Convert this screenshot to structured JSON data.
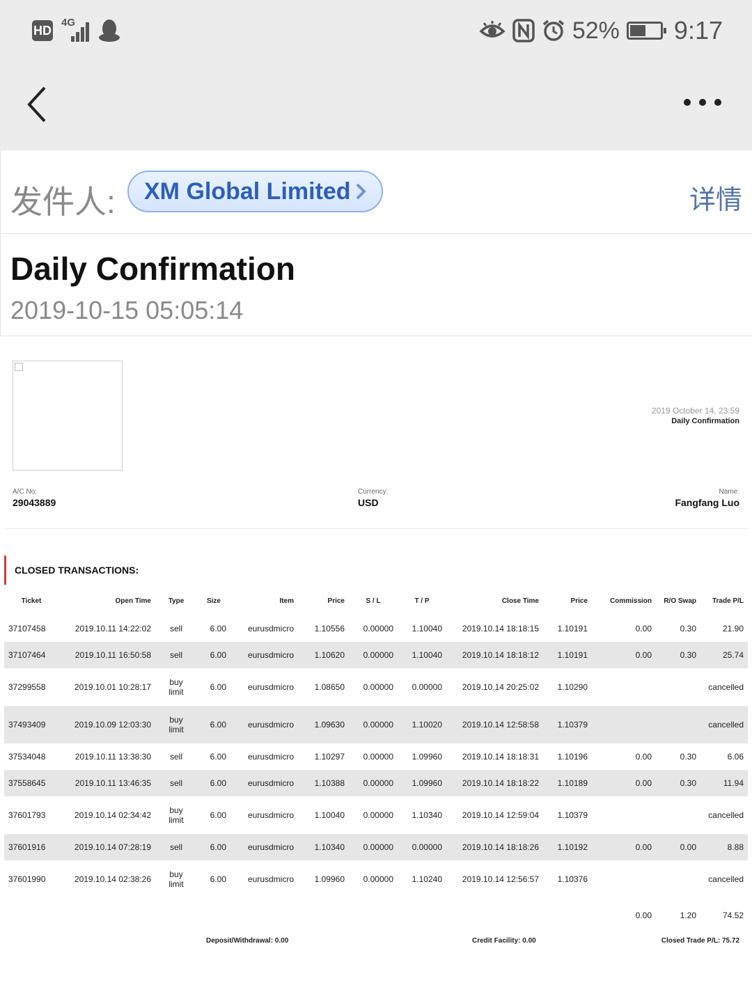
{
  "status_bar": {
    "hd_label": "HD",
    "network_label": "4G",
    "battery_percent_label": "52%",
    "battery_level": 0.52,
    "time": "9:17",
    "icons": [
      "hd-icon",
      "signal-icon",
      "qq-penguin-icon",
      "eye-icon",
      "nfc-icon",
      "alarm-icon",
      "battery-icon"
    ]
  },
  "nav": {
    "back_icon": "chevron-left-icon",
    "more_icon": "more-dots-icon"
  },
  "sender": {
    "label": "发件人:",
    "name": "XM Global Limited",
    "details_label": "详情"
  },
  "subject": {
    "title": "Daily Confirmation",
    "date": "2019-10-15 05:05:14"
  },
  "email": {
    "report_date": "2019 October 14, 23:59",
    "report_title": "Daily Confirmation",
    "account": {
      "ac_label": "A/C No:",
      "ac_value": "29043889",
      "currency_label": "Currency:",
      "currency_value": "USD",
      "name_label": "Name:",
      "name_value": "Fangfang Luo"
    },
    "section_title": "CLOSED TRANSACTIONS:",
    "columns": [
      "Ticket",
      "Open Time",
      "Type",
      "Size",
      "Item",
      "Price",
      "S / L",
      "T / P",
      "Close Time",
      "Price",
      "Commission",
      "R/O Swap",
      "Trade P/L"
    ],
    "rows": [
      {
        "ticket": "37107458",
        "open_time": "2019.10.11 14:22:02",
        "type": "sell",
        "type2": "",
        "size": "6.00",
        "item": "eurusdmicro",
        "price": "1.10556",
        "sl": "0.00000",
        "tp": "1.10040",
        "close_time": "2019.10.14 18:18:15",
        "close_price": "1.10191",
        "commission": "0.00",
        "swap": "0.30",
        "pl": "21.90"
      },
      {
        "ticket": "37107464",
        "open_time": "2019.10.11 16:50:58",
        "type": "sell",
        "type2": "",
        "size": "6.00",
        "item": "eurusdmicro",
        "price": "1.10620",
        "sl": "0.00000",
        "tp": "1.10040",
        "close_time": "2019.10.14 18:18:12",
        "close_price": "1.10191",
        "commission": "0.00",
        "swap": "0.30",
        "pl": "25.74"
      },
      {
        "ticket": "37299558",
        "open_time": "2019.10.01 10:28:17",
        "type": "buy",
        "type2": "limit",
        "size": "6.00",
        "item": "eurusdmicro",
        "price": "1.08650",
        "sl": "0.00000",
        "tp": "0.00000",
        "close_time": "2019.10.14 20:25:02",
        "close_price": "1.10290",
        "commission": "",
        "swap": "",
        "pl": "cancelled"
      },
      {
        "ticket": "37493409",
        "open_time": "2019.10.09 12:03:30",
        "type": "buy",
        "type2": "limit",
        "size": "6.00",
        "item": "eurusdmicro",
        "price": "1.09630",
        "sl": "0.00000",
        "tp": "1.10020",
        "close_time": "2019.10.14 12:58:58",
        "close_price": "1.10379",
        "commission": "",
        "swap": "",
        "pl": "cancelled"
      },
      {
        "ticket": "37534048",
        "open_time": "2019.10.11 13:38:30",
        "type": "sell",
        "type2": "",
        "size": "6.00",
        "item": "eurusdmicro",
        "price": "1.10297",
        "sl": "0.00000",
        "tp": "1.09960",
        "close_time": "2019.10.14 18:18:31",
        "close_price": "1.10196",
        "commission": "0.00",
        "swap": "0.30",
        "pl": "6.06"
      },
      {
        "ticket": "37558645",
        "open_time": "2019.10.11 13:46:35",
        "type": "sell",
        "type2": "",
        "size": "6.00",
        "item": "eurusdmicro",
        "price": "1.10388",
        "sl": "0.00000",
        "tp": "1.09960",
        "close_time": "2019.10.14 18:18:22",
        "close_price": "1.10189",
        "commission": "0.00",
        "swap": "0.30",
        "pl": "11.94"
      },
      {
        "ticket": "37601793",
        "open_time": "2019.10.14 02:34:42",
        "type": "buy",
        "type2": "limit",
        "size": "6.00",
        "item": "eurusdmicro",
        "price": "1.10040",
        "sl": "0.00000",
        "tp": "1.10340",
        "close_time": "2019.10.14 12:59:04",
        "close_price": "1.10379",
        "commission": "",
        "swap": "",
        "pl": "cancelled"
      },
      {
        "ticket": "37601916",
        "open_time": "2019.10.14 07:28:19",
        "type": "sell",
        "type2": "",
        "size": "6.00",
        "item": "eurusdmicro",
        "price": "1.10340",
        "sl": "0.00000",
        "tp": "0.00000",
        "close_time": "2019.10.14 18:18:26",
        "close_price": "1.10192",
        "commission": "0.00",
        "swap": "0.00",
        "pl": "8.88"
      },
      {
        "ticket": "37601990",
        "open_time": "2019.10.14 02:38:26",
        "type": "buy",
        "type2": "limit",
        "size": "6.00",
        "item": "eurusdmicro",
        "price": "1.09960",
        "sl": "0.00000",
        "tp": "1.10240",
        "close_time": "2019.10.14 12:56:57",
        "close_price": "1.10376",
        "commission": "",
        "swap": "",
        "pl": "cancelled"
      }
    ],
    "totals": {
      "commission": "0.00",
      "swap": "1.20",
      "pl": "74.52"
    },
    "footer": {
      "deposit": "Deposit/Withdrawal: 0.00",
      "credit": "Credit Facility: 0.00",
      "closed_pl": "Closed Trade P/L: 75.72"
    }
  }
}
